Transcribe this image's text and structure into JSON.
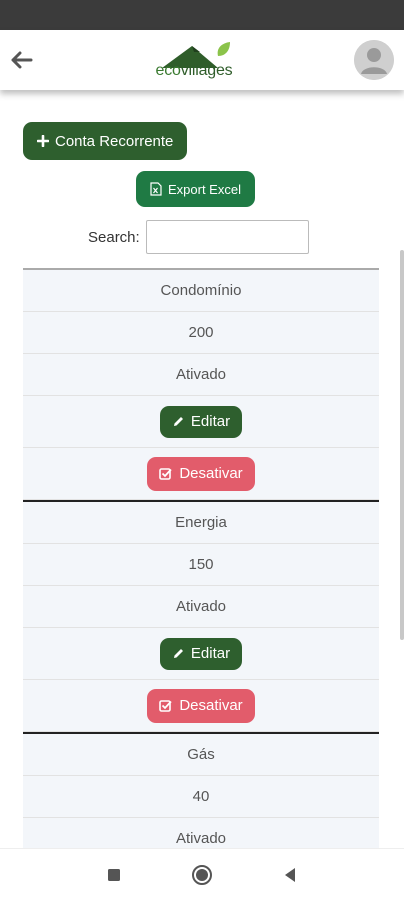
{
  "header": {
    "logo_text_eco": "eco",
    "logo_text_villages": "villages",
    "back_icon": "arrow-left-icon",
    "avatar_icon": "user-avatar-icon"
  },
  "actions": {
    "add_label": "Conta Recorrente",
    "export_label": "Export Excel"
  },
  "search": {
    "label": "Search:",
    "value": "",
    "placeholder": ""
  },
  "records": [
    {
      "name": "Condomínio",
      "value": "200",
      "status": "Ativado",
      "edit_label": "Editar",
      "deactivate_label": "Desativar"
    },
    {
      "name": "Energia",
      "value": "150",
      "status": "Ativado",
      "edit_label": "Editar",
      "deactivate_label": "Desativar"
    },
    {
      "name": "Gás",
      "value": "40",
      "status": "Ativado"
    }
  ],
  "colors": {
    "primary": "#2e5f2e",
    "export": "#1f7a44",
    "danger": "#e25c6b",
    "row_bg": "#f3f6fa"
  },
  "nav": {
    "square_icon": "recent-apps-icon",
    "home_icon": "home-circle-icon",
    "back_icon": "triangle-back-icon"
  }
}
